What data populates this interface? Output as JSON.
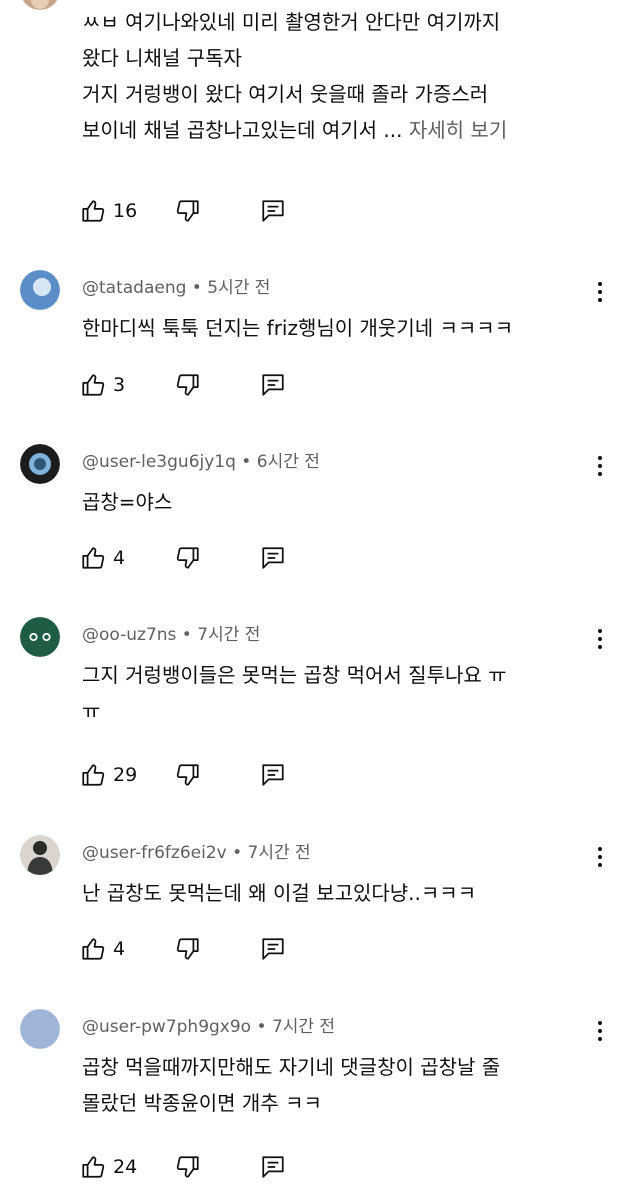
{
  "comments": [
    {
      "author": "",
      "time": "",
      "lines": [
        "ㅆㅂ 여기나와있네 미리 촬영한거 안다만 여기까지",
        "왔다 니채널 구독자",
        "거지 거렁뱅이 왔다 여기서 웃을때 졸라 가증스러",
        "보이네 채널 곱창나고있는데 여기서 ..."
      ],
      "more_label": "자세히 보기",
      "likes": "16",
      "avatar_color": "#c9a58c"
    },
    {
      "author": "@tatadaeng",
      "time": "5시간 전",
      "lines": [
        "한마디씩 툭툭 던지는 friz행님이 개웃기네 ㅋㅋㅋㅋ"
      ],
      "likes": "3",
      "avatar_color": "#5b8ec9"
    },
    {
      "author": "@user-le3gu6jy1q",
      "time": "6시간 전",
      "lines": [
        "곱창=야스"
      ],
      "likes": "4",
      "avatar_color": "#1c1c1c"
    },
    {
      "author": "@oo-uz7ns",
      "time": "7시간 전",
      "lines": [
        "그지 거렁뱅이들은 못먹는 곱창 먹어서 질투나요 ㅠ",
        "ㅠ"
      ],
      "likes": "29",
      "avatar_color": "#1f5c45"
    },
    {
      "author": "@user-fr6fz6ei2v",
      "time": "7시간 전",
      "lines": [
        "난 곱창도 못먹는데 왜 이걸 보고있다냥..ㅋㅋㅋ"
      ],
      "likes": "4",
      "avatar_color": "#3a3a3a"
    },
    {
      "author": "@user-pw7ph9gx9o",
      "time": "7시간 전",
      "lines": [
        "곱창 먹을때까지만해도 자기네 댓글창이 곱창날 줄",
        "몰랐던 박종윤이면 개추 ㅋㅋ"
      ],
      "likes": "24",
      "avatar_color": "#9fb5d8"
    }
  ]
}
